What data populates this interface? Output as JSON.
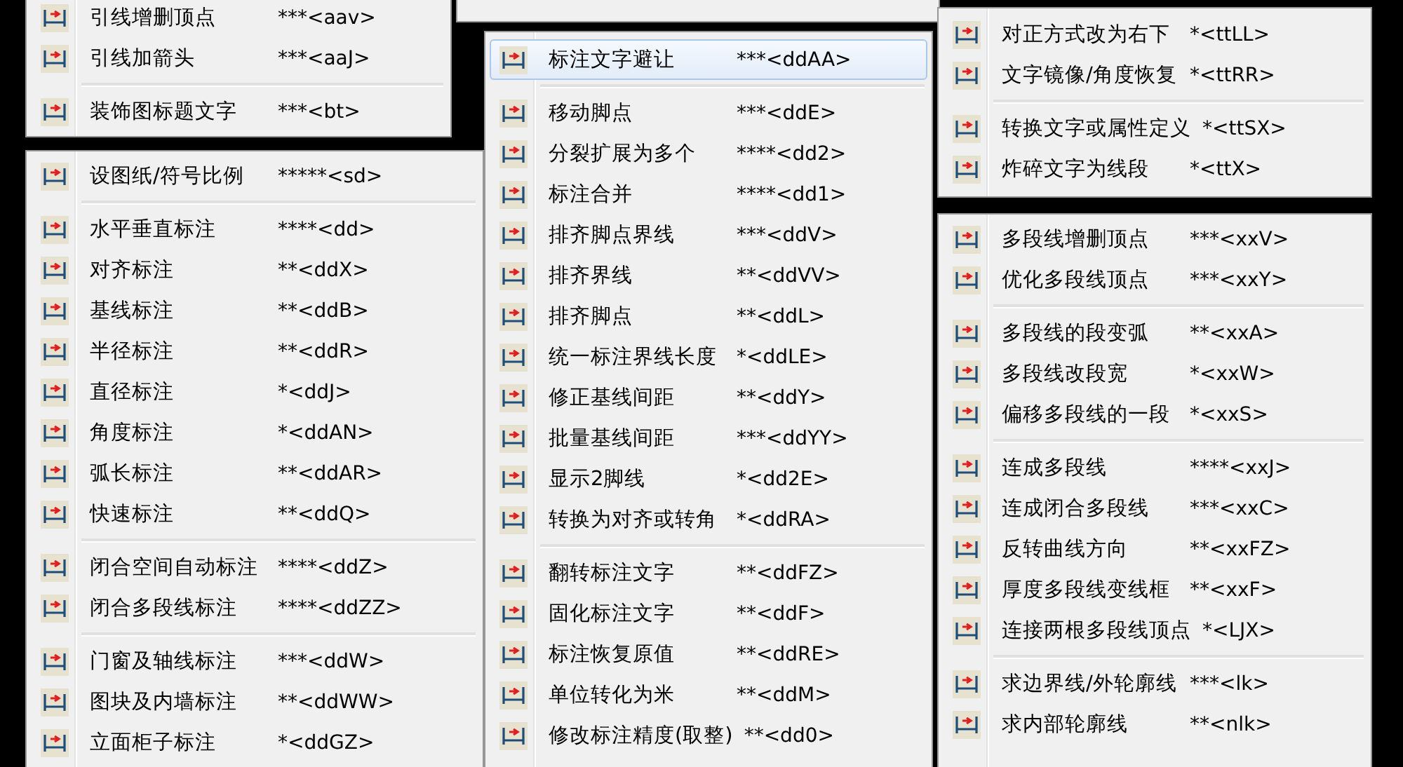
{
  "menus": [
    {
      "groups": [
        [
          {
            "label": "引线增删顶点",
            "shortcut": "***<aav>",
            "selected": false
          },
          {
            "label": "引线加箭头",
            "shortcut": "***<aaJ>",
            "selected": false
          }
        ],
        [
          {
            "label": "装饰图标题文字",
            "shortcut": "***<bt>",
            "selected": false
          }
        ]
      ]
    },
    {
      "groups": [
        [
          {
            "label": "设图纸/符号比例",
            "shortcut": "*****<sd>",
            "selected": false
          }
        ],
        [
          {
            "label": "水平垂直标注",
            "shortcut": "****<dd>",
            "selected": false
          },
          {
            "label": "对齐标注",
            "shortcut": "**<ddX>",
            "selected": false
          },
          {
            "label": "基线标注",
            "shortcut": "**<ddB>",
            "selected": false
          },
          {
            "label": "半径标注",
            "shortcut": "**<ddR>",
            "selected": false
          },
          {
            "label": "直径标注",
            "shortcut": "*<ddJ>",
            "selected": false
          },
          {
            "label": "角度标注",
            "shortcut": "*<ddAN>",
            "selected": false
          },
          {
            "label": "弧长标注",
            "shortcut": "**<ddAR>",
            "selected": false
          },
          {
            "label": "快速标注",
            "shortcut": "**<ddQ>",
            "selected": false
          }
        ],
        [
          {
            "label": "闭合空间自动标注",
            "shortcut": "****<ddZ>",
            "selected": false
          },
          {
            "label": "闭合多段线标注",
            "shortcut": "****<ddZZ>",
            "selected": false
          }
        ],
        [
          {
            "label": "门窗及轴线标注",
            "shortcut": "***<ddW>",
            "selected": false
          },
          {
            "label": "图块及内墙标注",
            "shortcut": "**<ddWW>",
            "selected": false
          },
          {
            "label": "立面柜子标注",
            "shortcut": "*<ddGZ>",
            "selected": false
          }
        ]
      ]
    },
    {
      "groups": [
        [
          {
            "label": "标注文字避让",
            "shortcut": "***<ddAA>",
            "selected": true
          }
        ],
        [
          {
            "label": "移动脚点",
            "shortcut": "***<ddE>",
            "selected": false
          },
          {
            "label": "分裂扩展为多个",
            "shortcut": "****<dd2>",
            "selected": false
          },
          {
            "label": "标注合并",
            "shortcut": "****<dd1>",
            "selected": false
          },
          {
            "label": "排齐脚点界线",
            "shortcut": "***<ddV>",
            "selected": false
          },
          {
            "label": "排齐界线",
            "shortcut": "**<ddVV>",
            "selected": false
          },
          {
            "label": "排齐脚点",
            "shortcut": "**<ddL>",
            "selected": false
          },
          {
            "label": "统一标注界线长度",
            "shortcut": "*<ddLE>",
            "selected": false
          },
          {
            "label": "修正基线间距",
            "shortcut": "**<ddY>",
            "selected": false
          },
          {
            "label": "批量基线间距",
            "shortcut": "***<ddYY>",
            "selected": false
          },
          {
            "label": "显示2脚线",
            "shortcut": "*<dd2E>",
            "selected": false
          },
          {
            "label": "转换为对齐或转角",
            "shortcut": "*<ddRA>",
            "selected": false
          }
        ],
        [
          {
            "label": "翻转标注文字",
            "shortcut": "**<ddFZ>",
            "selected": false
          },
          {
            "label": "固化标注文字",
            "shortcut": "**<ddF>",
            "selected": false
          },
          {
            "label": "标注恢复原值",
            "shortcut": "**<ddRE>",
            "selected": false
          },
          {
            "label": "单位转化为米",
            "shortcut": "**<ddM>",
            "selected": false
          },
          {
            "label": "修改标注精度(取整)",
            "shortcut": "**<dd0>",
            "selected": false
          }
        ]
      ]
    },
    {
      "groups": [
        [
          {
            "label": "对正方式改为右下",
            "shortcut": "*<ttLL>",
            "selected": false
          },
          {
            "label": "文字镜像/角度恢复",
            "shortcut": "*<ttRR>",
            "selected": false
          }
        ],
        [
          {
            "label": "转换文字或属性定义",
            "shortcut": "*<ttSX>",
            "selected": false
          },
          {
            "label": "炸碎文字为线段",
            "shortcut": "*<ttX>",
            "selected": false
          }
        ]
      ]
    },
    {
      "groups": [
        [
          {
            "label": "多段线增删顶点",
            "shortcut": "***<xxV>",
            "selected": false
          },
          {
            "label": "优化多段线顶点",
            "shortcut": "***<xxY>",
            "selected": false
          }
        ],
        [
          {
            "label": "多段线的段变弧",
            "shortcut": "**<xxA>",
            "selected": false
          },
          {
            "label": "多段线改段宽",
            "shortcut": "*<xxW>",
            "selected": false
          },
          {
            "label": "偏移多段线的一段",
            "shortcut": "*<xxS>",
            "selected": false
          }
        ],
        [
          {
            "label": "连成多段线",
            "shortcut": "****<xxJ>",
            "selected": false
          },
          {
            "label": "连成闭合多段线",
            "shortcut": "***<xxC>",
            "selected": false
          },
          {
            "label": "反转曲线方向",
            "shortcut": "**<xxFZ>",
            "selected": false
          },
          {
            "label": "厚度多段线变线框",
            "shortcut": "**<xxF>",
            "selected": false
          },
          {
            "label": "连接两根多段线顶点",
            "shortcut": "*<LJX>",
            "selected": false
          }
        ],
        [
          {
            "label": "求边界线/外轮廓线",
            "shortcut": "***<lk>",
            "selected": false
          },
          {
            "label": "求内部轮廓线",
            "shortcut": "**<nlk>",
            "selected": false
          }
        ]
      ]
    }
  ]
}
